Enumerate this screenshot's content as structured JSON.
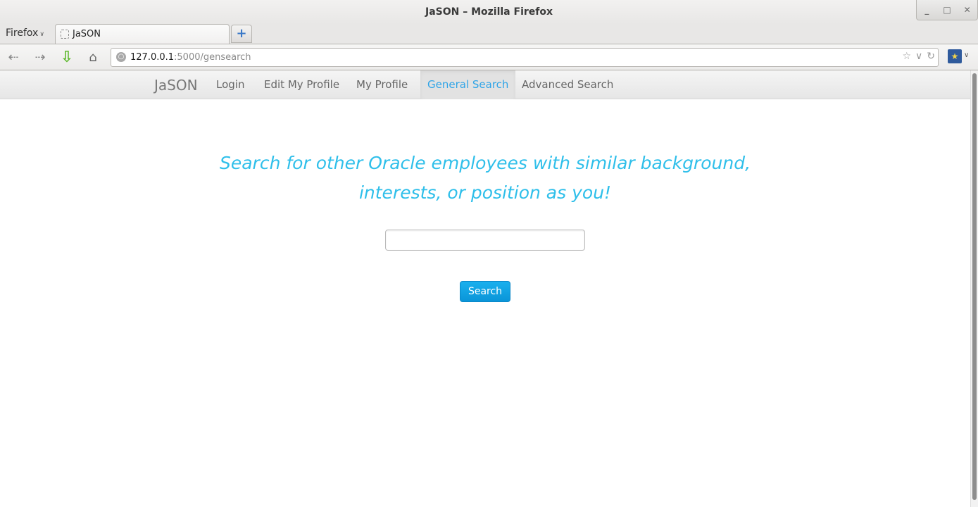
{
  "window": {
    "title": "JaSON – Mozilla Firefox",
    "controls": [
      "_",
      "□",
      "✕"
    ]
  },
  "browser": {
    "menu_label": "Firefox",
    "tabs": [
      {
        "label": "JaSON"
      }
    ],
    "new_tab_label": "+",
    "url_host": "127.0.0.1",
    "url_rest": ":5000/gensearch"
  },
  "site": {
    "brand": "JaSON",
    "nav": [
      {
        "label": "Login",
        "active": false
      },
      {
        "label": "Edit My Profile",
        "active": false
      },
      {
        "label": "My Profile",
        "active": false
      },
      {
        "label": "General Search",
        "active": true
      },
      {
        "label": "Advanced Search",
        "active": false
      }
    ]
  },
  "main": {
    "headline_line1": "Search for other Oracle employees with similar background,",
    "headline_line2": "interests, or position as you!",
    "search_value": "",
    "search_button": "Search"
  },
  "colors": {
    "accent": "#2fa4e7",
    "headline": "#2fbfea",
    "button": "#0a95d8"
  }
}
